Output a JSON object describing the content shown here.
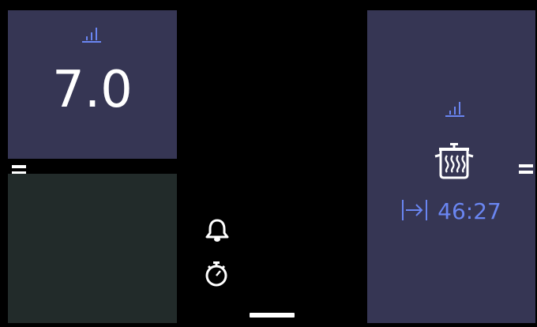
{
  "colors": {
    "background": "#000000",
    "zone_active": "#363654",
    "zone_inactive": "#222b2a",
    "accent": "#6a86f2",
    "text": "#ffffff"
  },
  "zones": {
    "top_left": {
      "icon": "power-level-icon",
      "value": "7.0"
    },
    "bottom_left": {
      "state": "empty"
    },
    "right": {
      "icon": "power-level-icon",
      "function_icon": "cooking-pot-steam-icon",
      "timer_icon": "end-time-arrow-icon",
      "timer_value": "46:27"
    }
  },
  "center_controls": {
    "alarm_icon": "bell-icon",
    "timer_icon": "stopwatch-icon"
  },
  "handles": {
    "left_icon": "drag-handle-icon",
    "right_icon": "drag-handle-icon"
  }
}
